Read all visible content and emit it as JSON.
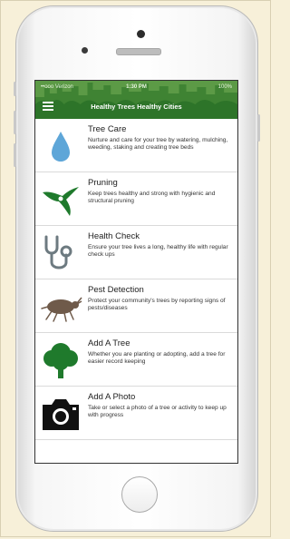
{
  "status_bar": {
    "carrier": "••ooo Verizon",
    "time": "1:30 PM",
    "battery": "100%"
  },
  "header": {
    "title": "Healthy Trees Healthy Cities"
  },
  "menu_items": [
    {
      "title": "Tree Care",
      "description": "Nurture and care for your tree by watering, mulching, weeding, staking and creating tree beds",
      "icon": "water-drop-icon"
    },
    {
      "title": "Pruning",
      "description": "Keep trees healthy and strong with hygienic and structural pruning",
      "icon": "pruning-shears-icon"
    },
    {
      "title": "Health Check",
      "description": "Ensure your tree lives a long, healthy life with regular check ups",
      "icon": "stethoscope-icon"
    },
    {
      "title": "Pest Detection",
      "description": "Protect your community's trees by reporting signs of pests/diseases",
      "icon": "beetle-icon"
    },
    {
      "title": "Add A Tree",
      "description": "Whether you are planting or adopting, add a tree for easier record keeping",
      "icon": "tree-icon"
    },
    {
      "title": "Add A Photo",
      "description": "Take or select a photo of a tree or activity to keep up with progress",
      "icon": "camera-icon"
    }
  ],
  "colors": {
    "header_green": "#3e8a35",
    "drop_blue": "#5ea6d8",
    "icon_green": "#1f7a2c",
    "icon_gray": "#6d7a80",
    "beetle_brown": "#6f5a4a"
  }
}
